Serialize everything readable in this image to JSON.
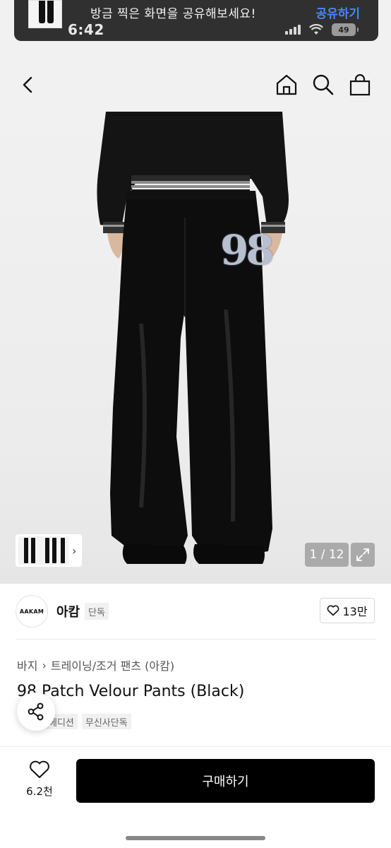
{
  "banner": {
    "message": "방금 찍은 화면을 공유해보세요!",
    "action_label": "공유하기"
  },
  "status_bar": {
    "time": "6:42",
    "battery": "49"
  },
  "nav": {
    "icons": [
      "chevron-left-icon",
      "home-icon",
      "search-icon",
      "bag-icon"
    ]
  },
  "gallery": {
    "counter": "1 / 12",
    "patch_text": "98",
    "thumb_arrow": "›"
  },
  "brand": {
    "logo_text": "AAKAM",
    "name": "아캄",
    "badge": "단독",
    "likes": "13만"
  },
  "product": {
    "breadcrumb": [
      "바지",
      "트레이닝/조거 팬츠 (아캄)"
    ],
    "title": "98 Patch Velour Pants (Black)",
    "tags": [
      "에디션",
      "무신사단독"
    ]
  },
  "bottom": {
    "wish_count": "6.2천",
    "buy_label": "구매하기"
  },
  "colors": {
    "primary_button": "#000000",
    "banner_action": "#4a86ff"
  }
}
